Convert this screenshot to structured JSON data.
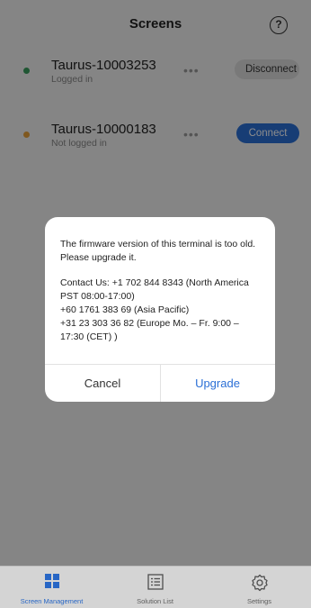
{
  "header": {
    "title": "Screens",
    "help_icon": "question-circle-icon",
    "help_glyph": "?"
  },
  "screens": [
    {
      "name": "Taurus-10003253",
      "status": "Logged in",
      "dot_color": "#3a9d5d",
      "more": "•••",
      "action": "Disconnect"
    },
    {
      "name": "Taurus-10000183",
      "status": "Not logged in",
      "dot_color": "#e8a13a",
      "more": "•••",
      "action": "Connect"
    }
  ],
  "dialog": {
    "message": "The firmware version of this terminal is too old. Please upgrade it.",
    "contact_lines": [
      "Contact Us: +1 702 844 8343 (North America",
      "PST 08:00-17:00)",
      "+60 1761 383 69 (Asia Pacific)",
      "+31 23 303 36 82 (Europe Mo. – Fr. 9:00 –",
      "17:30 (CET) )"
    ],
    "cancel_label": "Cancel",
    "upgrade_label": "Upgrade"
  },
  "tabs": [
    {
      "label": "Screen Management",
      "icon": "grid-icon",
      "active": true
    },
    {
      "label": "Solution List",
      "icon": "list-icon",
      "active": false
    },
    {
      "label": "Settings",
      "icon": "gear-icon",
      "active": false
    }
  ],
  "colors": {
    "accent": "#2b6fd6",
    "online": "#3a9d5d",
    "offline": "#e8a13a"
  }
}
